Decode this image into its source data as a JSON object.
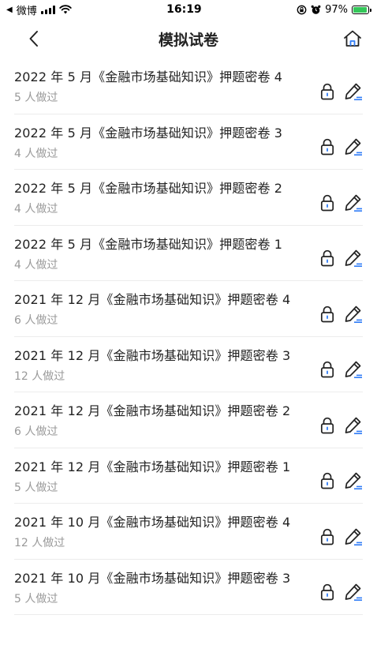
{
  "status": {
    "carrier": "微博",
    "time": "16:19",
    "battery": "97%",
    "battery_level": 0.97
  },
  "header": {
    "title": "模拟试卷"
  },
  "papers": [
    {
      "title": "2022 年 5 月《金融市场基础知识》押题密卷 4",
      "count": "5 人做过"
    },
    {
      "title": "2022 年 5 月《金融市场基础知识》押题密卷 3",
      "count": "4 人做过"
    },
    {
      "title": "2022 年 5 月《金融市场基础知识》押题密卷 2",
      "count": "4 人做过"
    },
    {
      "title": "2022 年 5 月《金融市场基础知识》押题密卷 1",
      "count": "4 人做过"
    },
    {
      "title": "2021 年 12 月《金融市场基础知识》押题密卷 4",
      "count": "6 人做过"
    },
    {
      "title": "2021 年 12 月《金融市场基础知识》押题密卷 3",
      "count": "12 人做过"
    },
    {
      "title": "2021 年 12 月《金融市场基础知识》押题密卷 2",
      "count": "6 人做过"
    },
    {
      "title": "2021 年 12 月《金融市场基础知识》押题密卷 1",
      "count": "5 人做过"
    },
    {
      "title": "2021 年 10 月《金融市场基础知识》押题密卷 4",
      "count": "12 人做过"
    },
    {
      "title": "2021 年 10 月《金融市场基础知识》押题密卷 3",
      "count": "5 人做过"
    }
  ],
  "icons": {
    "back": "chevron-left-icon",
    "home": "home-icon",
    "lock": "lock-icon",
    "edit": "pencil-icon"
  },
  "colors": {
    "accent": "#2f7cf6",
    "battery": "#34c759"
  }
}
